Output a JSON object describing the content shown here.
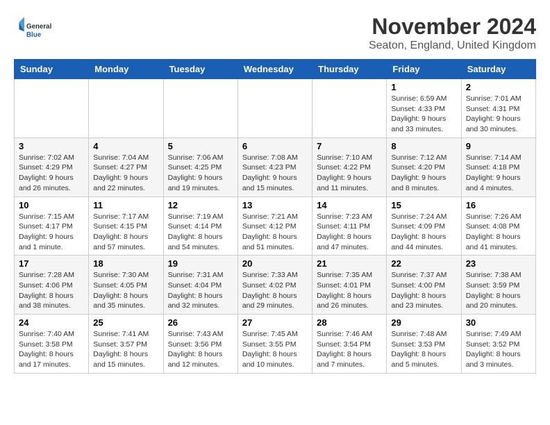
{
  "header": {
    "logo_general": "General",
    "logo_blue": "Blue",
    "month_year": "November 2024",
    "location": "Seaton, England, United Kingdom"
  },
  "weekdays": [
    "Sunday",
    "Monday",
    "Tuesday",
    "Wednesday",
    "Thursday",
    "Friday",
    "Saturday"
  ],
  "weeks": [
    [
      {
        "day": "",
        "info": ""
      },
      {
        "day": "",
        "info": ""
      },
      {
        "day": "",
        "info": ""
      },
      {
        "day": "",
        "info": ""
      },
      {
        "day": "",
        "info": ""
      },
      {
        "day": "1",
        "info": "Sunrise: 6:59 AM\nSunset: 4:33 PM\nDaylight: 9 hours\nand 33 minutes."
      },
      {
        "day": "2",
        "info": "Sunrise: 7:01 AM\nSunset: 4:31 PM\nDaylight: 9 hours\nand 30 minutes."
      }
    ],
    [
      {
        "day": "3",
        "info": "Sunrise: 7:02 AM\nSunset: 4:29 PM\nDaylight: 9 hours\nand 26 minutes."
      },
      {
        "day": "4",
        "info": "Sunrise: 7:04 AM\nSunset: 4:27 PM\nDaylight: 9 hours\nand 22 minutes."
      },
      {
        "day": "5",
        "info": "Sunrise: 7:06 AM\nSunset: 4:25 PM\nDaylight: 9 hours\nand 19 minutes."
      },
      {
        "day": "6",
        "info": "Sunrise: 7:08 AM\nSunset: 4:23 PM\nDaylight: 9 hours\nand 15 minutes."
      },
      {
        "day": "7",
        "info": "Sunrise: 7:10 AM\nSunset: 4:22 PM\nDaylight: 9 hours\nand 11 minutes."
      },
      {
        "day": "8",
        "info": "Sunrise: 7:12 AM\nSunset: 4:20 PM\nDaylight: 9 hours\nand 8 minutes."
      },
      {
        "day": "9",
        "info": "Sunrise: 7:14 AM\nSunset: 4:18 PM\nDaylight: 9 hours\nand 4 minutes."
      }
    ],
    [
      {
        "day": "10",
        "info": "Sunrise: 7:15 AM\nSunset: 4:17 PM\nDaylight: 9 hours\nand 1 minute."
      },
      {
        "day": "11",
        "info": "Sunrise: 7:17 AM\nSunset: 4:15 PM\nDaylight: 8 hours\nand 57 minutes."
      },
      {
        "day": "12",
        "info": "Sunrise: 7:19 AM\nSunset: 4:14 PM\nDaylight: 8 hours\nand 54 minutes."
      },
      {
        "day": "13",
        "info": "Sunrise: 7:21 AM\nSunset: 4:12 PM\nDaylight: 8 hours\nand 51 minutes."
      },
      {
        "day": "14",
        "info": "Sunrise: 7:23 AM\nSunset: 4:11 PM\nDaylight: 8 hours\nand 47 minutes."
      },
      {
        "day": "15",
        "info": "Sunrise: 7:24 AM\nSunset: 4:09 PM\nDaylight: 8 hours\nand 44 minutes."
      },
      {
        "day": "16",
        "info": "Sunrise: 7:26 AM\nSunset: 4:08 PM\nDaylight: 8 hours\nand 41 minutes."
      }
    ],
    [
      {
        "day": "17",
        "info": "Sunrise: 7:28 AM\nSunset: 4:06 PM\nDaylight: 8 hours\nand 38 minutes."
      },
      {
        "day": "18",
        "info": "Sunrise: 7:30 AM\nSunset: 4:05 PM\nDaylight: 8 hours\nand 35 minutes."
      },
      {
        "day": "19",
        "info": "Sunrise: 7:31 AM\nSunset: 4:04 PM\nDaylight: 8 hours\nand 32 minutes."
      },
      {
        "day": "20",
        "info": "Sunrise: 7:33 AM\nSunset: 4:02 PM\nDaylight: 8 hours\nand 29 minutes."
      },
      {
        "day": "21",
        "info": "Sunrise: 7:35 AM\nSunset: 4:01 PM\nDaylight: 8 hours\nand 26 minutes."
      },
      {
        "day": "22",
        "info": "Sunrise: 7:37 AM\nSunset: 4:00 PM\nDaylight: 8 hours\nand 23 minutes."
      },
      {
        "day": "23",
        "info": "Sunrise: 7:38 AM\nSunset: 3:59 PM\nDaylight: 8 hours\nand 20 minutes."
      }
    ],
    [
      {
        "day": "24",
        "info": "Sunrise: 7:40 AM\nSunset: 3:58 PM\nDaylight: 8 hours\nand 17 minutes."
      },
      {
        "day": "25",
        "info": "Sunrise: 7:41 AM\nSunset: 3:57 PM\nDaylight: 8 hours\nand 15 minutes."
      },
      {
        "day": "26",
        "info": "Sunrise: 7:43 AM\nSunset: 3:56 PM\nDaylight: 8 hours\nand 12 minutes."
      },
      {
        "day": "27",
        "info": "Sunrise: 7:45 AM\nSunset: 3:55 PM\nDaylight: 8 hours\nand 10 minutes."
      },
      {
        "day": "28",
        "info": "Sunrise: 7:46 AM\nSunset: 3:54 PM\nDaylight: 8 hours\nand 7 minutes."
      },
      {
        "day": "29",
        "info": "Sunrise: 7:48 AM\nSunset: 3:53 PM\nDaylight: 8 hours\nand 5 minutes."
      },
      {
        "day": "30",
        "info": "Sunrise: 7:49 AM\nSunset: 3:52 PM\nDaylight: 8 hours\nand 3 minutes."
      }
    ]
  ]
}
